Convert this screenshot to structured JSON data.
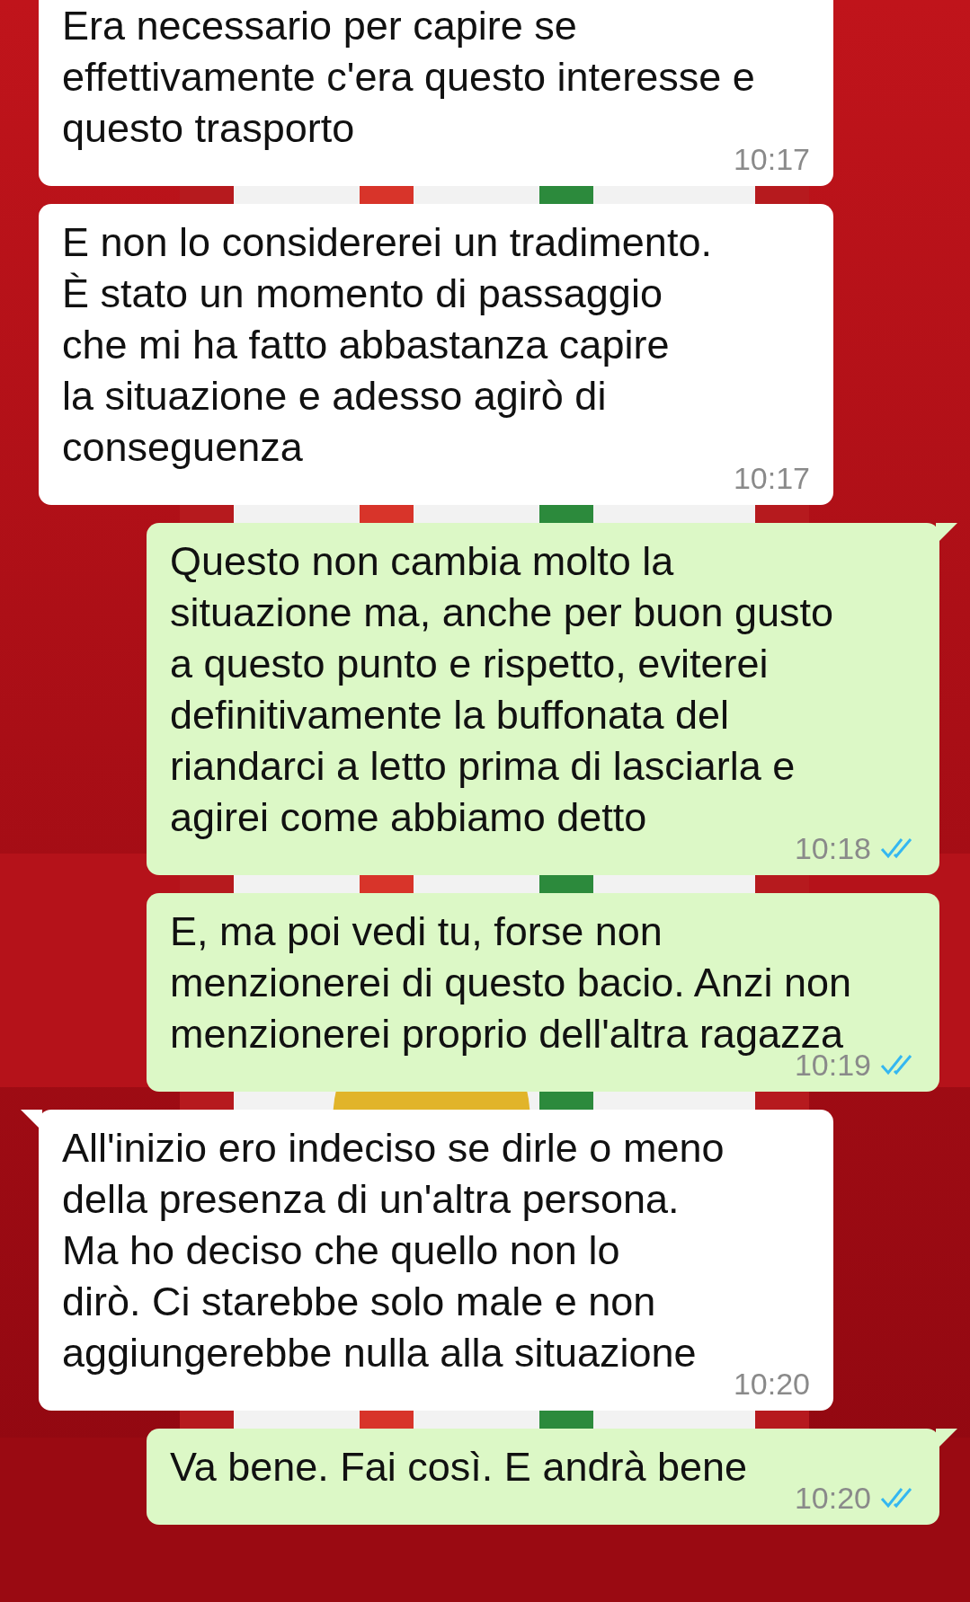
{
  "messages": [
    {
      "kind": "in",
      "text": "Era necessario per capire se\neffettivamente c'era questo interesse e\nquesto trasporto",
      "time": "10:17",
      "tail": false
    },
    {
      "kind": "in",
      "text": "E non lo considererei un tradimento.\nÈ stato un momento di passaggio\nche mi ha fatto abbastanza capire\nla situazione e adesso agirò di\nconseguenza",
      "time": "10:17",
      "tail": false
    },
    {
      "kind": "out",
      "text": "Questo non cambia molto la\nsituazione ma, anche per buon gusto\na questo punto e rispetto, eviterei\ndefinitivamente la buffonata del\nriandarci a letto prima di lasciarla e\nagirei come abbiamo detto",
      "time": "10:18",
      "read": true,
      "tail": true
    },
    {
      "kind": "out",
      "text": "E, ma poi vedi tu, forse non\nmenzionerei di questo bacio. Anzi non\nmenzionerei proprio dell'altra ragazza",
      "time": "10:19",
      "read": true,
      "tail": false
    },
    {
      "kind": "in",
      "text": "All'inizio ero indeciso se dirle o meno\ndella presenza di un'altra persona.\nMa ho deciso che quello non lo\ndirò. Ci starebbe solo male e non\naggiungerebbe nulla alla situazione",
      "time": "10:20",
      "tail": true
    },
    {
      "kind": "out",
      "text": "Va bene. Fai così. E andrà bene",
      "time": "10:20",
      "read": true,
      "tail": true
    }
  ]
}
